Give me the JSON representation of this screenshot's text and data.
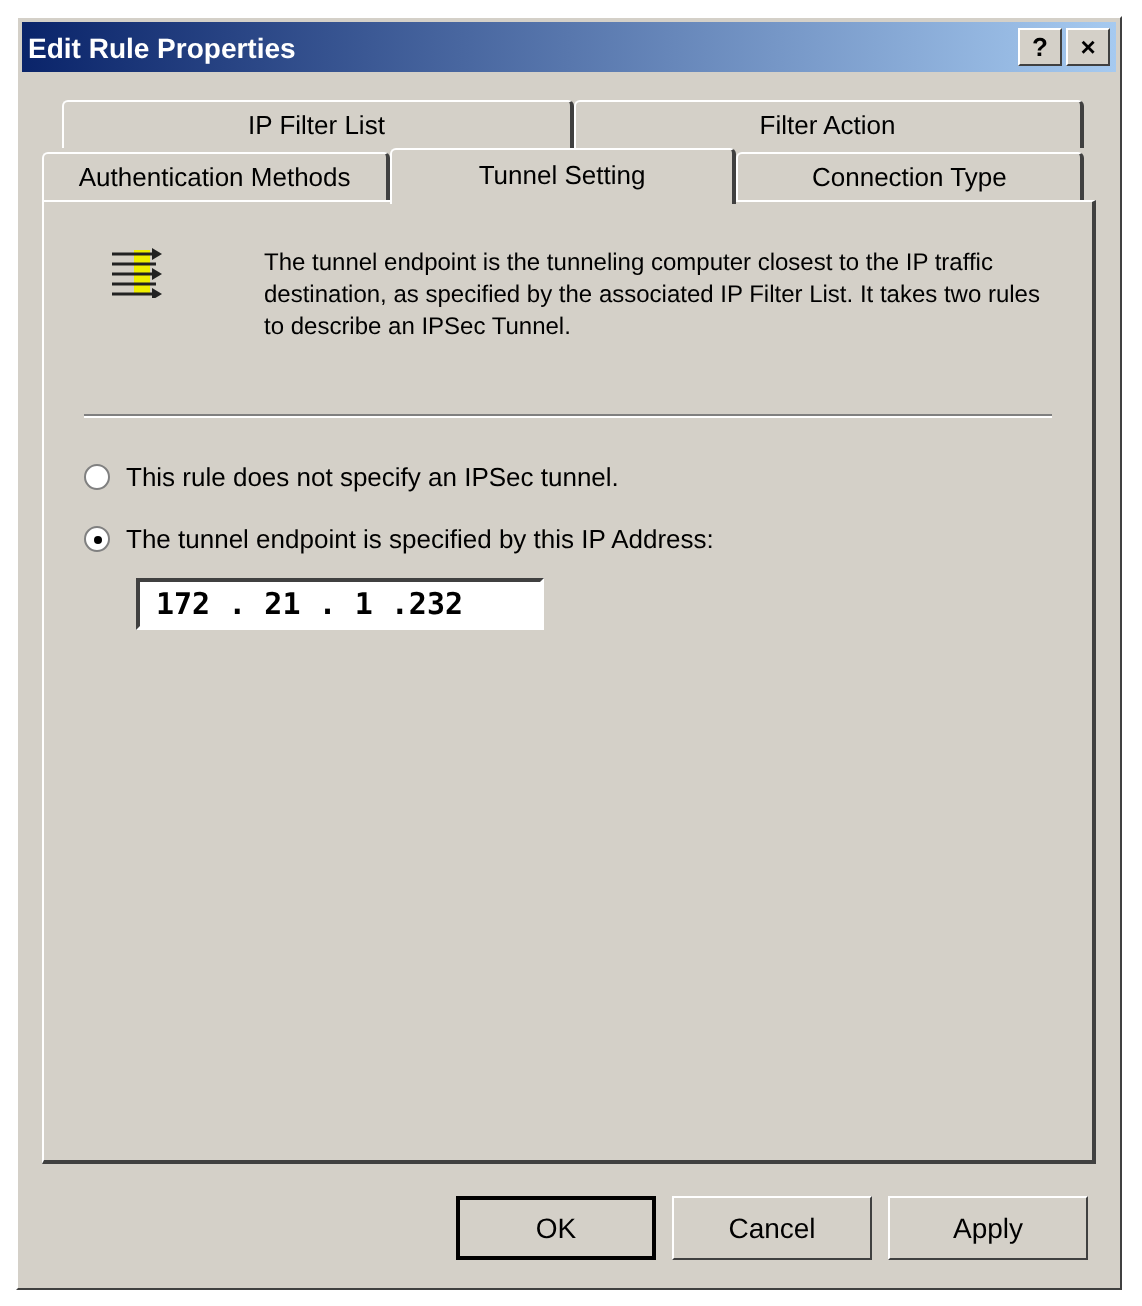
{
  "window": {
    "title": "Edit Rule Properties",
    "controls": [
      "?",
      "×"
    ]
  },
  "tab_rows": [
    [
      {
        "label": "IP Filter List",
        "selected": false
      },
      {
        "label": "Filter Action",
        "selected": false
      }
    ],
    [
      {
        "label": "Authentication Methods",
        "selected": false
      },
      {
        "label": "Tunnel Setting",
        "selected": true
      },
      {
        "label": "Connection Type",
        "selected": false
      }
    ]
  ],
  "description": "The tunnel endpoint is the tunneling computer closest to the IP traffic destination, as specified by the associated IP Filter List. It takes two rules to describe an IPSec Tunnel.",
  "options": [
    {
      "label": "This rule does not specify an IPSec tunnel.",
      "selected": false
    },
    {
      "label": "The tunnel endpoint is specified by this IP Address:",
      "selected": true
    }
  ],
  "ip_address": "172 . 21 . 1 .232",
  "buttons": [
    {
      "label": "OK",
      "default": true
    },
    {
      "label": "Cancel",
      "default": false
    },
    {
      "label": "Apply",
      "default": false
    }
  ]
}
